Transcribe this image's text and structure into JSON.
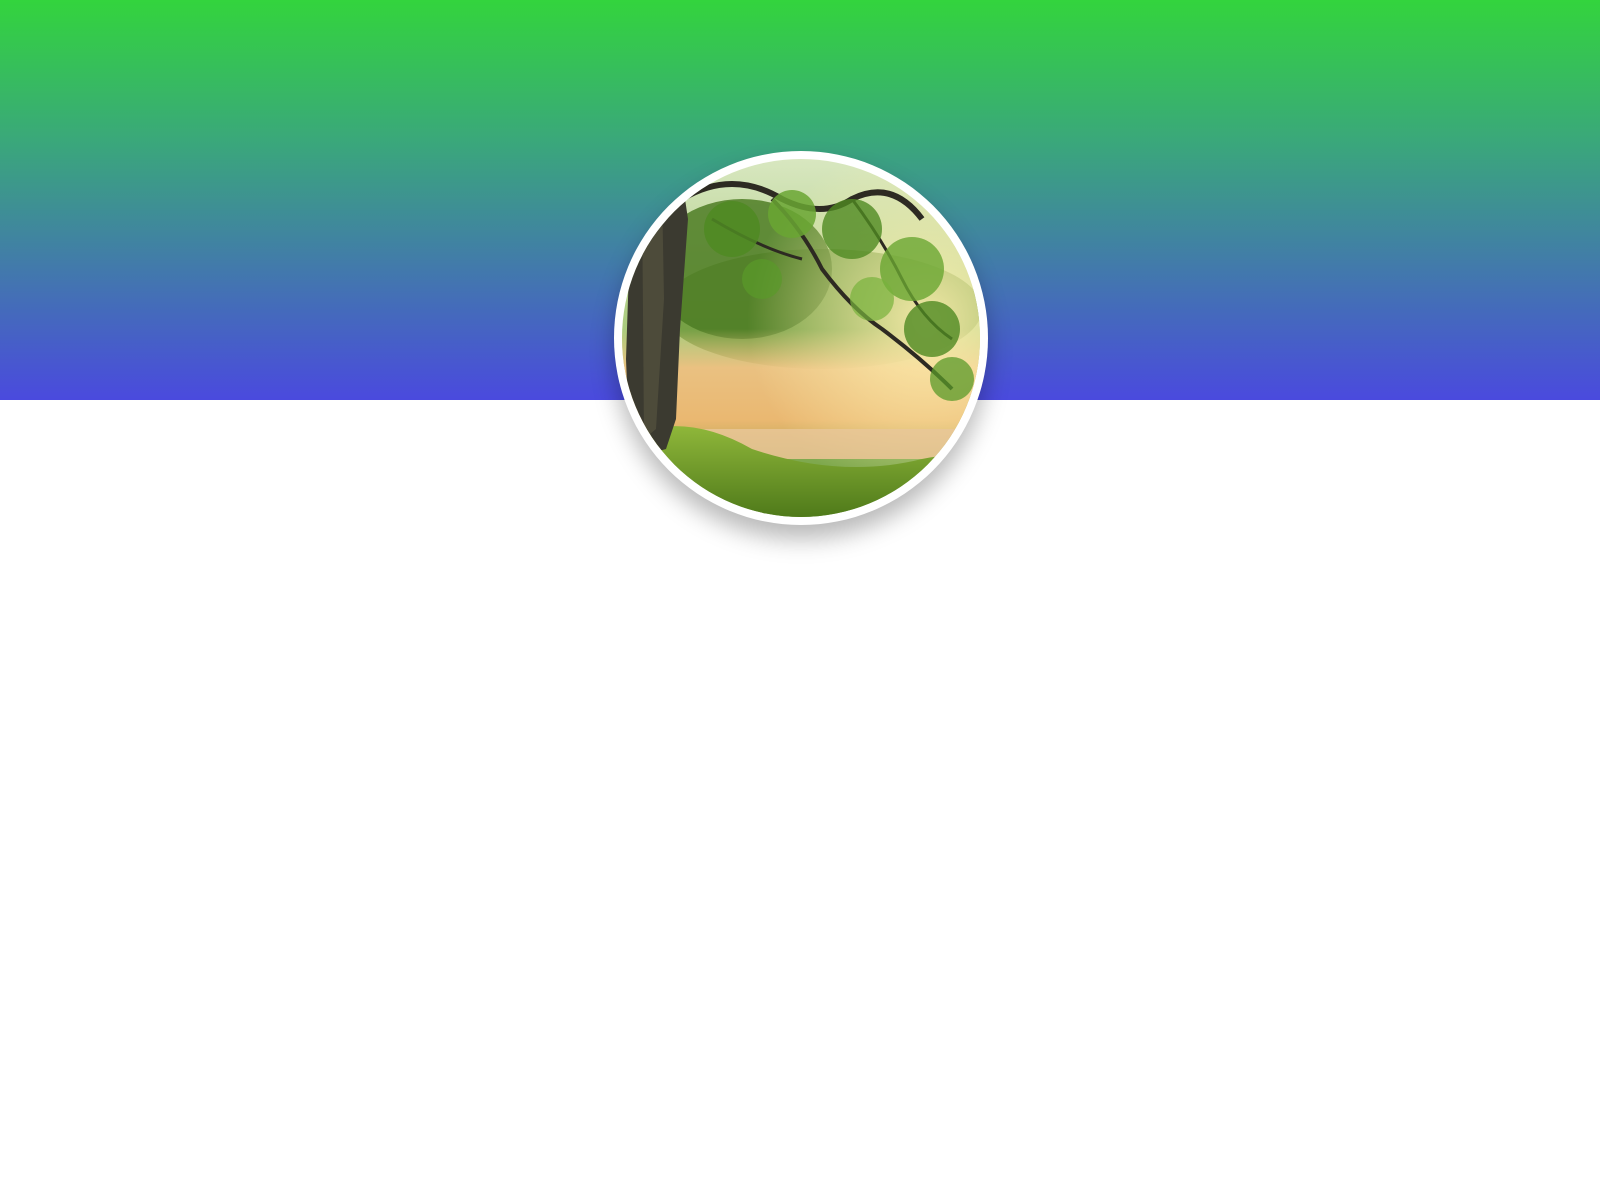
{
  "profile": {
    "cover": {
      "gradient_top": "#33d43d",
      "gradient_mid": "#3aa87a",
      "gradient_bottom": "#4a4ade"
    },
    "avatar": {
      "subject": "misty-river-landscape-with-tree",
      "border_color": "#ffffff"
    }
  }
}
